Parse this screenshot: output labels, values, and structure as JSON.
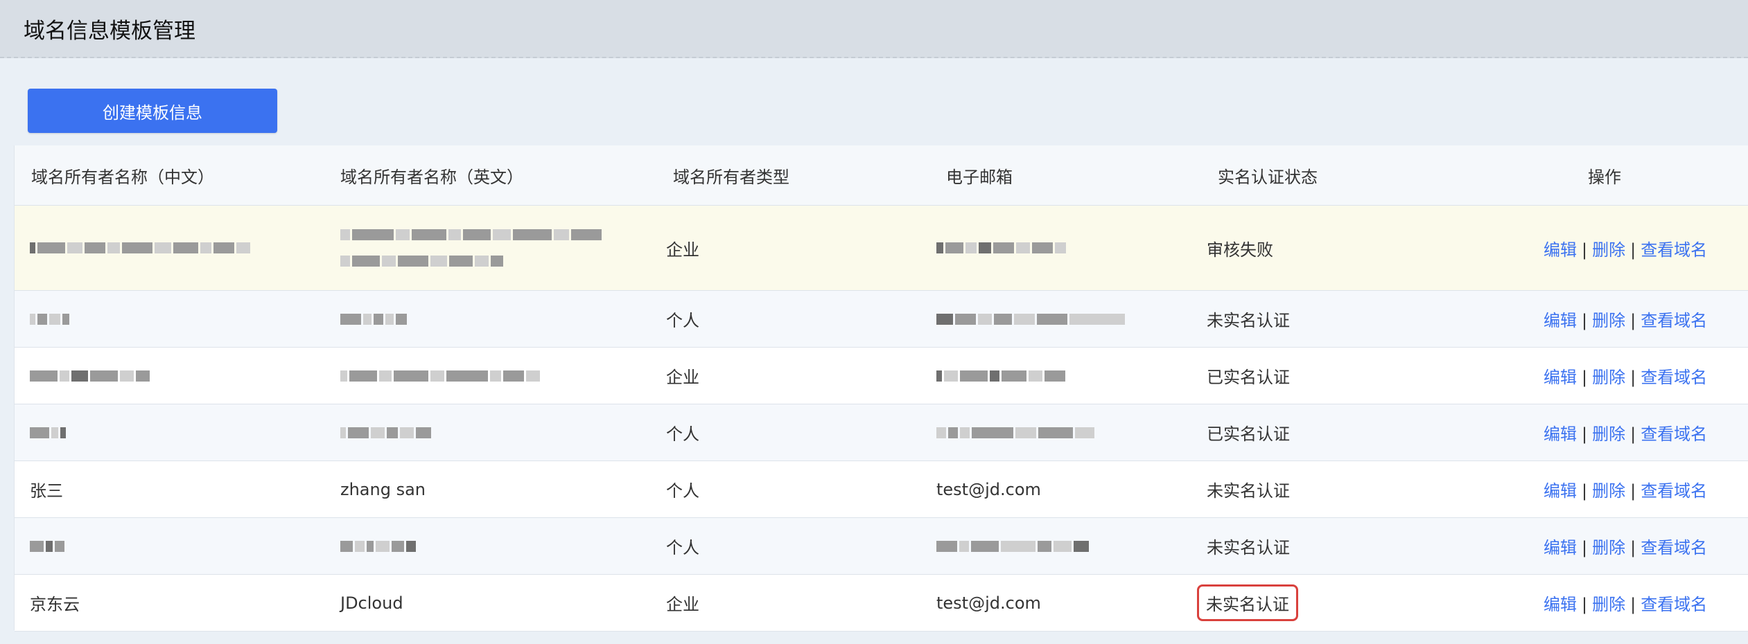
{
  "page": {
    "title": "域名信息模板管理"
  },
  "toolbar": {
    "create_label": "创建模板信息"
  },
  "table": {
    "headers": [
      "域名所有者名称（中文）",
      "域名所有者名称（英文）",
      "域名所有者类型",
      "电子邮箱",
      "实名认证状态",
      "操作"
    ],
    "actions": {
      "edit": "编辑",
      "delete": "删除",
      "view": "查看域名",
      "separator": "|"
    },
    "rows": [
      {
        "name_cn": "",
        "name_en": "",
        "type": "企业",
        "email": "",
        "status": "审核失败"
      },
      {
        "name_cn": "",
        "name_en": "",
        "type": "个人",
        "email": "",
        "status": "未实名认证"
      },
      {
        "name_cn": "",
        "name_en": "",
        "type": "企业",
        "email": "",
        "status": "已实名认证"
      },
      {
        "name_cn": "",
        "name_en": "",
        "type": "个人",
        "email": "",
        "status": "已实名认证"
      },
      {
        "name_cn": "张三",
        "name_en": "zhang san",
        "type": "个人",
        "email": "test@jd.com",
        "status": "未实名认证"
      },
      {
        "name_cn": "",
        "name_en": "",
        "type": "个人",
        "email": "",
        "status": "未实名认证"
      },
      {
        "name_cn": "京东云",
        "name_en": "JDcloud",
        "type": "企业",
        "email": "test@jd.com",
        "status": "未实名认证"
      }
    ]
  },
  "colors": {
    "accent": "#3b72f0",
    "highlight_border": "#d9413d",
    "header_bg": "#d8dee5"
  }
}
